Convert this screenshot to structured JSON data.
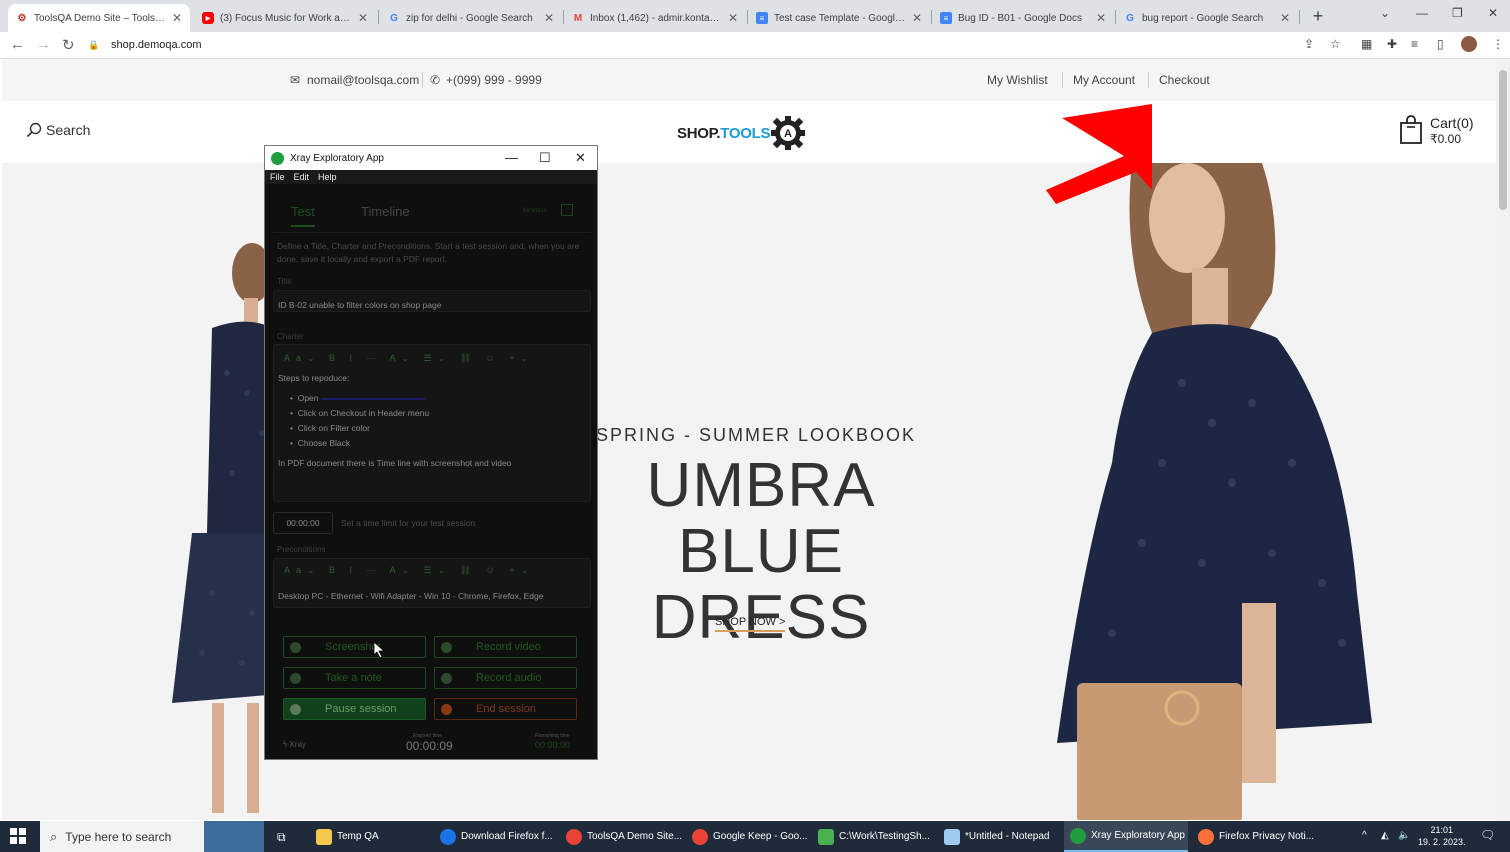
{
  "browser": {
    "tabs": [
      {
        "title": "ToolsQA Demo Site – ToolsQA – ",
        "icon": "gear",
        "active": true
      },
      {
        "title": "(3) Focus Music for Work and St",
        "icon": "youtube"
      },
      {
        "title": "zip for delhi - Google Search",
        "icon": "google"
      },
      {
        "title": "Inbox (1,462) - admir.kontakt@g",
        "icon": "gmail"
      },
      {
        "title": "Test case Template - Google Do",
        "icon": "docs"
      },
      {
        "title": "Bug ID - B01 - Google Docs",
        "icon": "docs"
      },
      {
        "title": "bug report - Google Search",
        "icon": "google"
      }
    ],
    "url": "shop.demoqa.com"
  },
  "site": {
    "email": "nomail@toolsqa.com",
    "phone": "+(099) 999 - 9999",
    "links": [
      "My Wishlist",
      "My Account",
      "Checkout"
    ],
    "search_label": "Search",
    "logo_shop": "SHOP.",
    "logo_tools": "TOOLS",
    "cart_label": "Cart(0)",
    "cart_amount": "₹0.00",
    "hero_subtitle": "SPRING - SUMMER LOOKBOOK",
    "hero_title_1": "UMBRA BLUE",
    "hero_title_2": "DRESS",
    "shop_now": "SHOP NOW >"
  },
  "xray": {
    "window_title": "Xray Exploratory App",
    "menu": [
      "File",
      "Edit",
      "Help"
    ],
    "tab_test": "Test",
    "tab_timeline": "Timeline",
    "minimize_label": "Minimize",
    "description": "Define a Title, Charter and Preconditions. Start a test session and, when you are done, save it locally and export a PDF report.",
    "title_label": "Title",
    "title_value": "ID B-02 unable to filter colors on shop page",
    "charter_label": "Charter",
    "toolbar_glyphs": "Aa⌄ B I ⋯ A⌄ ☰⌄ ⛓ ☺ +⌄",
    "charter_intro": "Steps to repoduce:",
    "charter_steps": [
      "Open",
      "Click on Checkout in Header menu",
      "Click on Filter color",
      "Choose Black"
    ],
    "charter_footer": "In PDF document there is Time line with screenshot and video",
    "time_limit_value": "00:00:00",
    "time_limit_hint": "Set a time limit for your test session",
    "preconditions_label": "Preconditions",
    "preconditions_value": "Desktop PC - Ethernet - Wifi Adapter - Win 10 - Chrome, Firefox, Edge",
    "btn_screenshot": "Screenshot",
    "btn_record_video": "Record video",
    "btn_take_note": "Take a note",
    "btn_record_audio": "Record audio",
    "btn_pause": "Pause session",
    "btn_end": "End session",
    "brand": "Xray",
    "elapsed_label": "Elapsed time",
    "elapsed_value": "00:00:09",
    "remaining_label": "Remaining time",
    "remaining_value": "00:00:00"
  },
  "taskbar": {
    "search_placeholder": "Type here to search",
    "items": [
      {
        "label": "Temp QA",
        "color": "#f2c94c"
      },
      {
        "label": "Download Firefox f...",
        "color": "#1a73e8"
      },
      {
        "label": "ToolsQA Demo Site...",
        "color": "#ea4335"
      },
      {
        "label": "Google Keep - Goo...",
        "color": "#ea4335"
      },
      {
        "label": "C:\\Work\\TestingSh...",
        "color": "#4caf50"
      },
      {
        "label": "*Untitled - Notepad",
        "color": "#9ecbf0"
      },
      {
        "label": "Xray Exploratory App",
        "color": "#1e9e3e"
      },
      {
        "label": "Firefox Privacy Noti...",
        "color": "#ff7139"
      }
    ],
    "time": "21:01",
    "date": "19. 2. 2023."
  },
  "colors": {
    "accent_arrow": "#ff0000",
    "logo_blue": "#1c9ad6",
    "xray_green": "#1e9e3e"
  }
}
